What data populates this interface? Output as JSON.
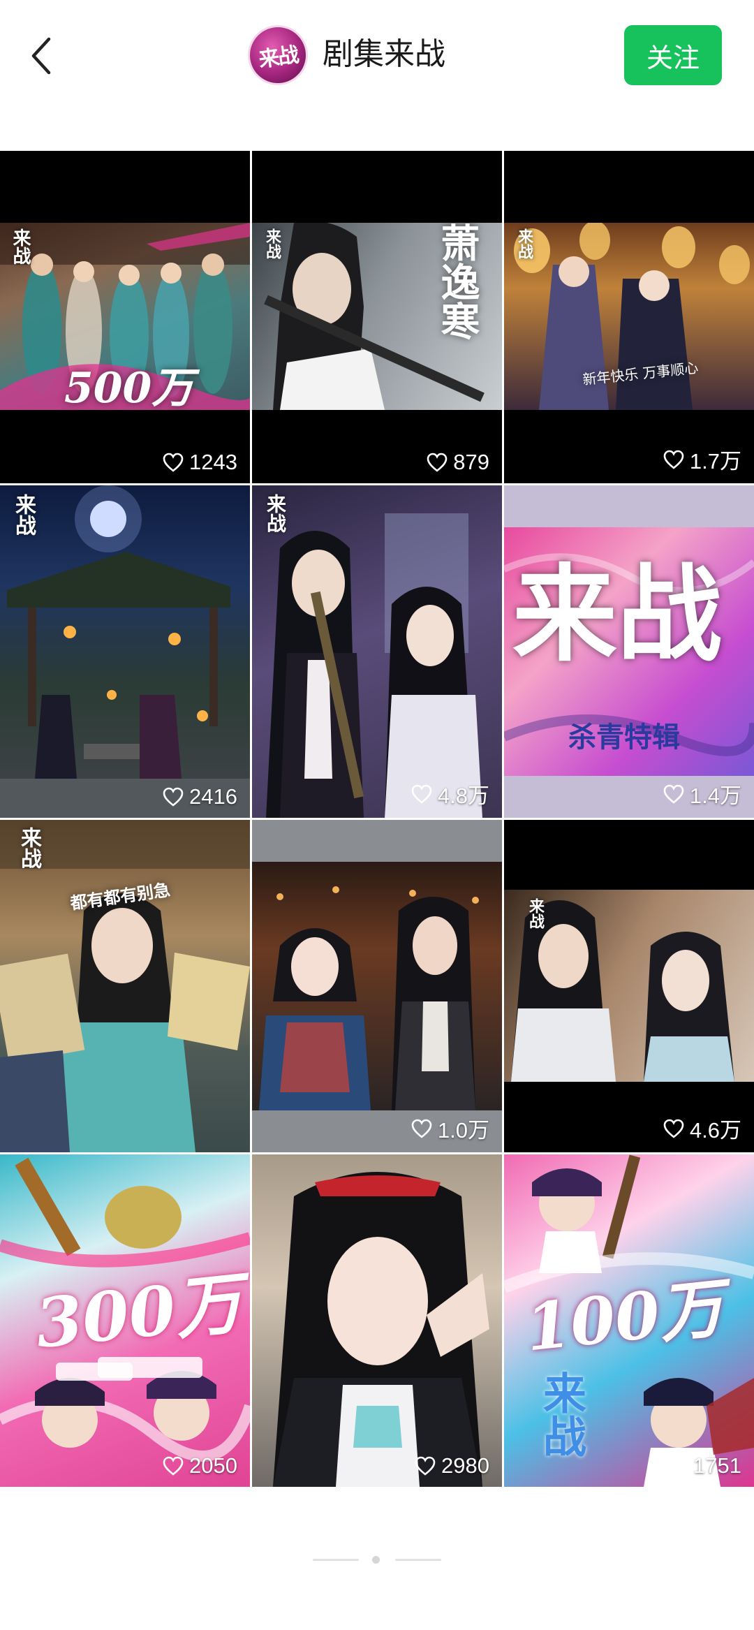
{
  "header": {
    "avatar_text": "来战",
    "channel_name": "剧集来战",
    "follow_label": "关注"
  },
  "tiles": [
    {
      "likes": "1243",
      "stamp": "来战",
      "caption": "500万"
    },
    {
      "likes": "879",
      "stamp": "来战",
      "caption": "萧逸寒"
    },
    {
      "likes": "1.7万",
      "stamp": "来战",
      "caption": "新年快乐 万事顺心"
    },
    {
      "likes": "2416",
      "stamp": "来战",
      "caption": ""
    },
    {
      "likes": "4.8万",
      "stamp": "来战",
      "caption": ""
    },
    {
      "likes": "1.4万",
      "stamp": "",
      "caption": "来战",
      "sub": "杀青特辑"
    },
    {
      "likes": "",
      "stamp": "来战",
      "caption": "都有都有别急"
    },
    {
      "likes": "1.0万",
      "stamp": "",
      "caption": ""
    },
    {
      "likes": "4.6万",
      "stamp": "来战",
      "caption": ""
    },
    {
      "likes": "2050",
      "stamp": "",
      "caption": "300万"
    },
    {
      "likes": "2980",
      "stamp": "",
      "caption": ""
    },
    {
      "likes": "1751",
      "stamp": "",
      "caption": "100万",
      "sub": "来战"
    }
  ],
  "colors": {
    "follow_bg": "#17c25c",
    "accent_pink": "#e0338f"
  },
  "icons": {
    "back": "chevron-left-icon",
    "like": "heart-outline-icon"
  }
}
